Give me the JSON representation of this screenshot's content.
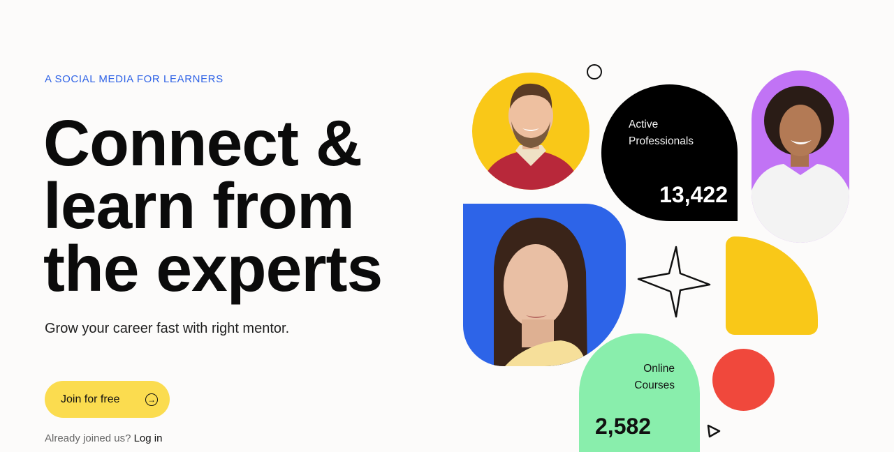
{
  "hero": {
    "eyebrow": "A SOCIAL MEDIA FOR LEARNERS",
    "headline_lines": [
      "Connect &",
      "learn from",
      "the experts"
    ],
    "subtitle": "Grow your career fast with right mentor.",
    "cta_label": "Join for free",
    "login_prompt": "Already joined us?",
    "login_link": "Log in"
  },
  "stats": [
    {
      "label_line1": "Active",
      "label_line2": "Professionals",
      "value": "13,422"
    },
    {
      "label_line1": "Online",
      "label_line2": "Courses",
      "value": "2,582"
    }
  ],
  "colors": {
    "accent_blue": "#2f63e6",
    "cta_yellow": "#fbdc4f",
    "shape_yellow": "#f9c818",
    "shape_purple": "#c173f5",
    "shape_blue": "#2d64e8",
    "shape_green": "#89eeac",
    "shape_red": "#f0483c",
    "stat_black": "#000000"
  },
  "icons": [
    "arrow-right-circle-icon",
    "sparkle-star-icon",
    "triangle-outline-icon",
    "circle-outline-icon"
  ]
}
